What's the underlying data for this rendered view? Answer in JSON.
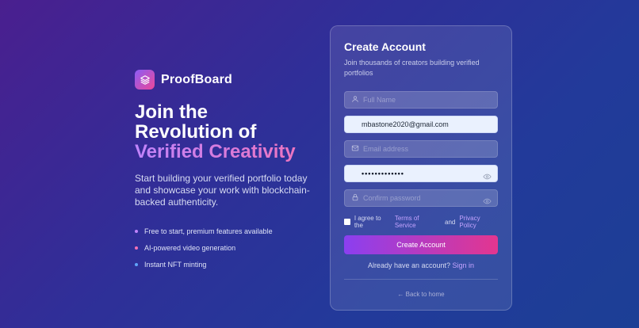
{
  "brand": {
    "name": "ProofBoard",
    "icon": "layers-icon"
  },
  "hero": {
    "headline_line1": "Join the",
    "headline_line2": "Revolution of",
    "headline_highlight": "Verified Creativity",
    "subtext": "Start building your verified portfolio today and showcase your work with blockchain-backed authenticity.",
    "features": [
      {
        "label": "Free to start, premium features available",
        "color": "#c084fc"
      },
      {
        "label": "AI-powered video generation",
        "color": "#f472b6"
      },
      {
        "label": "Instant NFT minting",
        "color": "#60a5fa"
      }
    ]
  },
  "form": {
    "title": "Create Account",
    "subtitle": "Join thousands of creators building verified portfolios",
    "full_name": {
      "placeholder": "Full Name",
      "value": ""
    },
    "username": {
      "value": "mbastone2020@gmail.com"
    },
    "email": {
      "placeholder": "Email address",
      "value": ""
    },
    "password": {
      "value_masked": "•••••••••••••"
    },
    "confirm_password": {
      "placeholder": "Confirm password",
      "value": ""
    },
    "agree": {
      "prefix": "I agree to the",
      "terms": "Terms of Service",
      "and": "and",
      "privacy": "Privacy Policy",
      "checked": false
    },
    "submit_label": "Create Account",
    "signin_prompt": "Already have an account?",
    "signin_link": "Sign in",
    "back_label": "← Back to home"
  }
}
